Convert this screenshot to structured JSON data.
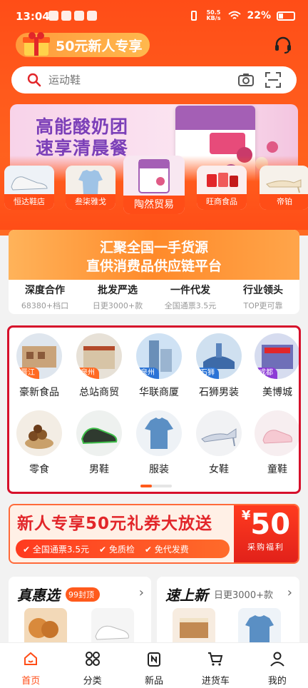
{
  "status_bar": {
    "time": "13:04",
    "net_speed": "50.5 KB/s",
    "battery": "22%"
  },
  "header": {
    "promo_label": "50元新人专享"
  },
  "search": {
    "placeholder": "运动鞋"
  },
  "banner": {
    "line1": "高能酸奶团",
    "line2": "速享清晨餐"
  },
  "shops": [
    {
      "label": "恒达鞋店"
    },
    {
      "label": "叁柒雅戈"
    },
    {
      "label": "陶然贸易"
    },
    {
      "label": "旺商食品"
    },
    {
      "label": "帝铂"
    }
  ],
  "supply": {
    "headline1": "汇聚全国一手货源",
    "headline2": "直供消费品供应链平台",
    "features": [
      {
        "title": "深度合作",
        "desc": "68380+档口"
      },
      {
        "title": "批发严选",
        "desc": "日更3000+款"
      },
      {
        "title": "一件代发",
        "desc": "全国通票3.5元"
      },
      {
        "title": "行业领头",
        "desc": "TOP更可靠"
      }
    ]
  },
  "categories": {
    "row1": [
      {
        "name": "豪新食品",
        "tag": "晋江"
      },
      {
        "name": "总站商贸",
        "tag": "泉州"
      },
      {
        "name": "华联商厦",
        "tag": "泉州"
      },
      {
        "name": "石狮男装",
        "tag": "石狮"
      },
      {
        "name": "美博城",
        "tag": "成都"
      }
    ],
    "row2": [
      {
        "name": "零食"
      },
      {
        "name": "男鞋"
      },
      {
        "name": "服装"
      },
      {
        "name": "女鞋"
      },
      {
        "name": "童鞋"
      }
    ],
    "page_indicator": {
      "current": 1,
      "total": 3
    }
  },
  "coupon": {
    "title": "新人专享50元礼券大放送",
    "benefits": [
      "全国通票3.5元",
      "免质检",
      "免代发费"
    ],
    "amount_symbol": "¥",
    "amount": "50",
    "subtitle": "采购福利"
  },
  "deals": {
    "left": {
      "title": "真惠选",
      "badge": "99封顶"
    },
    "right": {
      "title": "速上新",
      "subtitle": "日更3000+款"
    }
  },
  "bottom_nav": [
    {
      "label": "首页",
      "icon": "home-icon",
      "active": true
    },
    {
      "label": "分类",
      "icon": "grid-icon",
      "active": false
    },
    {
      "label": "新品",
      "icon": "new-icon",
      "active": false
    },
    {
      "label": "进货车",
      "icon": "cart-icon",
      "active": false
    },
    {
      "label": "我的",
      "icon": "user-icon",
      "active": false
    }
  ],
  "colors": {
    "brand": "#ff4d17",
    "highlight": "#d6102b"
  }
}
